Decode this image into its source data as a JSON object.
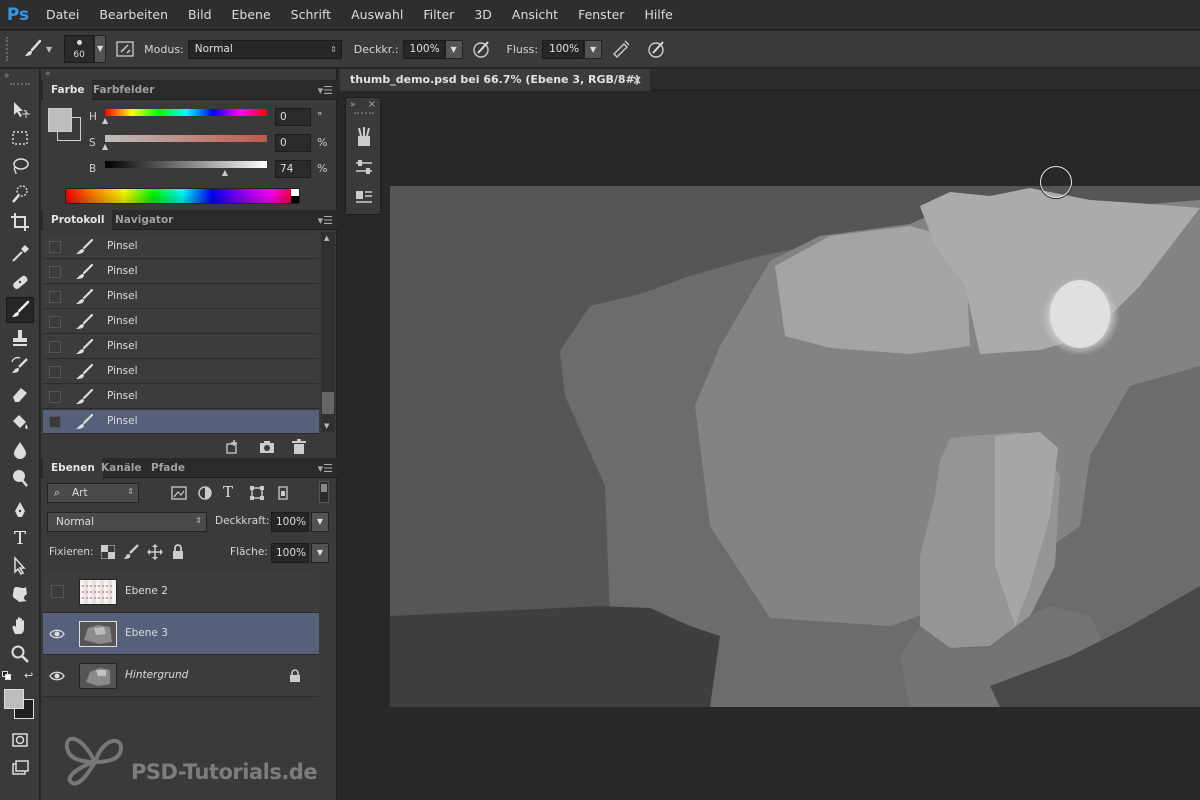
{
  "app": {
    "logo": "Ps"
  },
  "menu": [
    "Datei",
    "Bearbeiten",
    "Bild",
    "Ebene",
    "Schrift",
    "Auswahl",
    "Filter",
    "3D",
    "Ansicht",
    "Fenster",
    "Hilfe"
  ],
  "options": {
    "brush_size": "60",
    "mode_label": "Modus:",
    "mode_value": "Normal",
    "opacity_label": "Deckkr.:",
    "opacity_value": "100%",
    "flow_label": "Fluss:",
    "flow_value": "100%"
  },
  "color_panel": {
    "tabs": [
      "Farbe",
      "Farbfelder"
    ],
    "h_label": "H",
    "h_value": "0",
    "h_unit": "°",
    "s_label": "S",
    "s_value": "0",
    "s_unit": "%",
    "b_label": "B",
    "b_value": "74",
    "b_unit": "%",
    "b_slider_fraction": 0.74
  },
  "history_panel": {
    "tabs": [
      "Protokoll",
      "Navigator"
    ],
    "items": [
      "Pinsel",
      "Pinsel",
      "Pinsel",
      "Pinsel",
      "Pinsel",
      "Pinsel",
      "Pinsel",
      "Pinsel"
    ],
    "selected_index": 7
  },
  "layers_panel": {
    "tabs": [
      "Ebenen",
      "Kanäle",
      "Pfade"
    ],
    "filter_kind": "Art",
    "blend_mode": "Normal",
    "opacity_label": "Deckkraft:",
    "opacity_value": "100%",
    "lock_label": "Fixieren:",
    "fill_label": "Fläche:",
    "fill_value": "100%",
    "layers": [
      {
        "name": "Ebene 2",
        "visible": false,
        "selected": false
      },
      {
        "name": "Ebene 3",
        "visible": true,
        "selected": true
      },
      {
        "name": "Hintergrund",
        "visible": true,
        "selected": false,
        "locked": true
      }
    ]
  },
  "document": {
    "tab_title": "thumb_demo.psd bei 66.7% (Ebene 3, RGB/8#) *",
    "close_glyph": "×"
  },
  "watermark": {
    "text": "PSD-Tutorials.de"
  },
  "colors": {
    "selection": "#56607a",
    "ps_blue": "#2f9be8",
    "panel_bg": "#3a3a3a"
  }
}
